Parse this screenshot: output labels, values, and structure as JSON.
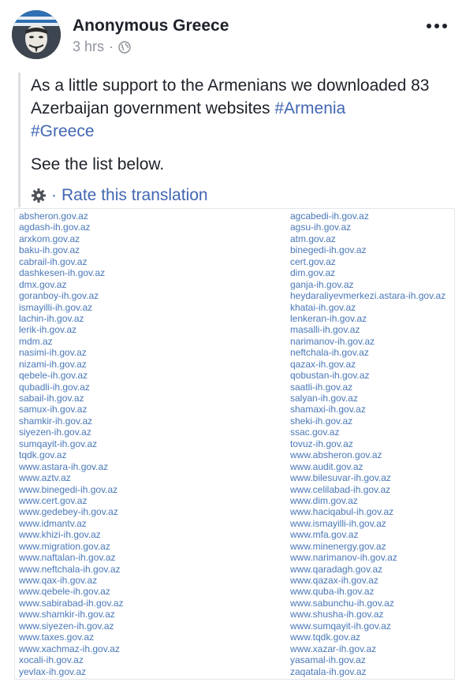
{
  "post": {
    "author": "Anonymous Greece",
    "time": "3 hrs",
    "separator": "·",
    "privacy_icon": "globe-icon",
    "more_icon": "more-options-icon",
    "text": "As a little support to the Armenians we downloaded 83 Azerbaijan government websites ",
    "hashtag_1": "#Armenia",
    "hashtag_2": "#Greece",
    "see_list": "See the list below.",
    "rate_icon": "gear-icon",
    "rate_separator": "·",
    "rate_translation": "Rate this translation"
  },
  "colors": {
    "link": "#4267b2",
    "list_link": "#4a78b8",
    "meta": "#90949c"
  },
  "sites_left": [
    "absheron.gov.az",
    "agdash-ih.gov.az",
    "arxkom.gov.az",
    "baku-ih.gov.az",
    "cabrail-ih.gov.az",
    "dashkesen-ih.gov.az",
    "dmx.gov.az",
    "goranboy-ih.gov.az",
    "ismayilli-ih.gov.az",
    "lachin-ih.gov.az",
    "lerik-ih.gov.az",
    "mdm.az",
    "nasimi-ih.gov.az",
    "nizami-ih.gov.az",
    "qebele-ih.gov.az",
    "qubadli-ih.gov.az",
    "sabail-ih.gov.az",
    "samux-ih.gov.az",
    "shamkir-ih.gov.az",
    "siyezen-ih.gov.az",
    "sumqayit-ih.gov.az",
    "tqdk.gov.az",
    "www.astara-ih.gov.az",
    "www.aztv.az",
    "www.binegedi-ih.gov.az",
    "www.cert.gov.az",
    "www.gedebey-ih.gov.az",
    "www.idmantv.az",
    "www.khizi-ih.gov.az",
    "www.migration.gov.az",
    "www.naftalan-ih.gov.az",
    "www.neftchala-ih.gov.az",
    "www.qax-ih.gov.az",
    "www.qebele-ih.gov.az",
    "www.sabirabad-ih.gov.az",
    "www.shamkir-ih.gov.az",
    "www.siyezen-ih.gov.az",
    "www.taxes.gov.az",
    "www.xachmaz-ih.gov.az",
    "xocali-ih.gov.az",
    "yevlax-ih.gov.az"
  ],
  "sites_right": [
    "agcabedi-ih.gov.az",
    "agsu-ih.gov.az",
    "atm.gov.az",
    "binegedi-ih.gov.az",
    "cert.gov.az",
    "dim.gov.az",
    "ganja-ih.gov.az",
    "heydaraliyevmerkezi.astara-ih.gov.az",
    "khatai-ih.gov.az",
    "lenkeran-ih.gov.az",
    "masalli-ih.gov.az",
    "narimanov-ih.gov.az",
    "neftchala-ih.gov.az",
    "qazax-ih.gov.az",
    "qobustan-ih.gov.az",
    "saatli-ih.gov.az",
    "salyan-ih.gov.az",
    "shamaxi-ih.gov.az",
    "sheki-ih.gov.az",
    "ssac.gov.az",
    "tovuz-ih.gov.az",
    "www.absheron.gov.az",
    "www.audit.gov.az",
    "www.bilesuvar-ih.gov.az",
    "www.celilabad-ih.gov.az",
    "www.dim.gov.az",
    "www.haciqabul-ih.gov.az",
    "www.ismayilli-ih.gov.az",
    "www.mfa.gov.az",
    "www.minenergy.gov.az",
    "www.narimanov-ih.gov.az",
    "www.qaradagh.gov.az",
    "www.qazax-ih.gov.az",
    "www.quba-ih.gov.az",
    "www.sabunchu-ih.gov.az",
    "www.shusha-ih.gov.az",
    "www.sumqayit-ih.gov.az",
    "www.tqdk.gov.az",
    "www.xazar-ih.gov.az",
    "yasamal-ih.gov.az",
    "zaqatala-ih.gov.az"
  ]
}
